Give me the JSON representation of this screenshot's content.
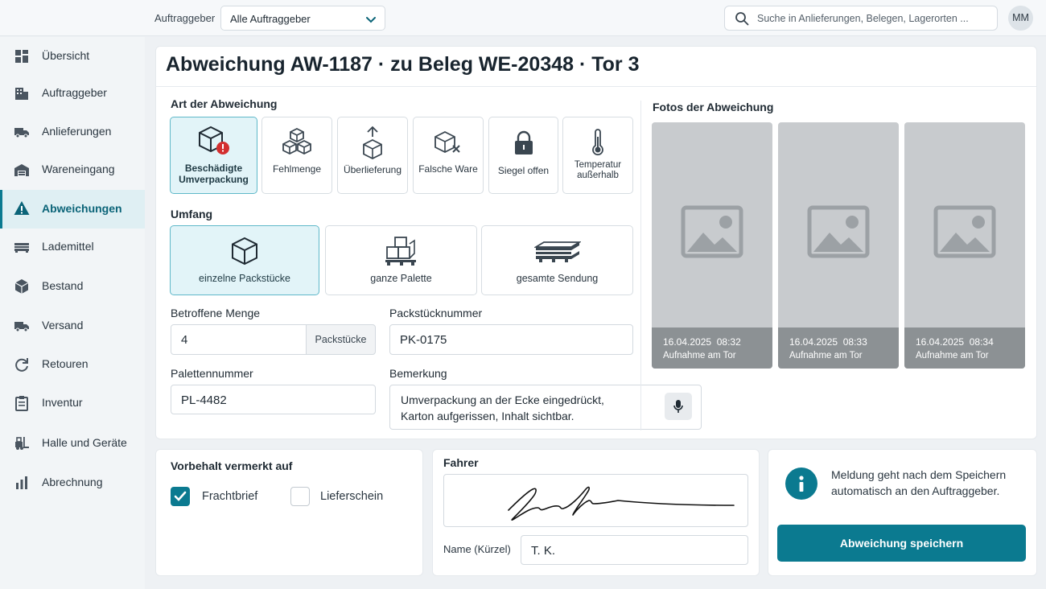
{
  "topbar": {
    "client_label": "Auftraggeber",
    "client_select": "Alle Auftraggeber",
    "search_placeholder": "Suche in Anlieferungen, Belegen, Lagerorten ...",
    "user_initials": "MM"
  },
  "sidebar": {
    "items": [
      {
        "label": "Übersicht",
        "icon": "dashboard-icon"
      },
      {
        "label": "Auftraggeber",
        "icon": "building-icon"
      },
      {
        "label": "Anlieferungen",
        "icon": "truck-icon"
      },
      {
        "label": "Wareneingang",
        "icon": "warehouse-icon"
      },
      {
        "label": "Abweichungen",
        "icon": "warning-icon",
        "active": true
      },
      {
        "label": "Lademittel",
        "icon": "pallet-icon"
      },
      {
        "label": "Bestand",
        "icon": "box-icon"
      },
      {
        "label": "Versand",
        "icon": "truck-icon"
      },
      {
        "label": "Retouren",
        "icon": "return-icon"
      },
      {
        "label": "Inventur",
        "icon": "clipboard-icon"
      },
      {
        "label": "Halle und Geräte",
        "icon": "forklift-icon"
      },
      {
        "label": "Abrechnung",
        "icon": "bar-chart-icon"
      }
    ]
  },
  "page": {
    "title": "Abweichung AW-1187 · zu Beleg WE-20348 · Tor 3"
  },
  "deviation_type": {
    "label": "Art der Abweichung",
    "options": [
      {
        "label": "Beschädigte Umverpackung",
        "icon": "damaged-box-icon",
        "selected": true
      },
      {
        "label": "Fehlmenge",
        "icon": "boxes-icon"
      },
      {
        "label": "Überlieferung",
        "icon": "box-arrow-up-icon"
      },
      {
        "label": "Falsche Ware",
        "icon": "box-x-icon"
      },
      {
        "label": "Siegel offen",
        "icon": "lock-icon"
      },
      {
        "label": "Temperatur außerhalb",
        "icon": "thermometer-icon"
      }
    ]
  },
  "scope": {
    "label": "Umfang",
    "options": [
      {
        "label": "einzelne Packstücke",
        "icon": "box-icon",
        "selected": true
      },
      {
        "label": "ganze Palette",
        "icon": "pallet-boxes-icon"
      },
      {
        "label": "gesamte Sendung",
        "icon": "pallet-icon"
      }
    ]
  },
  "fields": {
    "quantity_label": "Betroffene Menge",
    "quantity_value": "4",
    "quantity_unit": "Packstücke",
    "package_label": "Packstücknummer",
    "package_value": "PK-0175",
    "pallet_label": "Palettennummer",
    "pallet_value": "PL-4482",
    "remark_label": "Bemerkung",
    "remark_line1": "Umverpackung an der Ecke eingedrückt,",
    "remark_line2": "Karton aufgerissen, Inhalt sichtbar."
  },
  "photos": {
    "label": "Fotos der Abweichung",
    "items": [
      {
        "date": "16.04.2025",
        "time": "08:32",
        "caption": "Aufnahme am Tor"
      },
      {
        "date": "16.04.2025",
        "time": "08:33",
        "caption": "Aufnahme am Tor"
      },
      {
        "date": "16.04.2025",
        "time": "08:34",
        "caption": "Aufnahme am Tor"
      }
    ]
  },
  "reservation": {
    "label": "Vorbehalt vermerkt auf",
    "options": [
      {
        "label": "Frachtbrief",
        "checked": true
      },
      {
        "label": "Lieferschein",
        "checked": false
      }
    ]
  },
  "driver": {
    "label": "Fahrer",
    "name_label": "Name (Kürzel)",
    "name_value": "T. K."
  },
  "notice": {
    "text": "Meldung geht nach dem Speichern automatisch an den Auftraggeber."
  },
  "actions": {
    "save_label": "Abweichung speichern"
  },
  "colors": {
    "accent": "#0b7a90",
    "selected_tile": "#e2f4f8",
    "alert": "#d32f2f"
  }
}
